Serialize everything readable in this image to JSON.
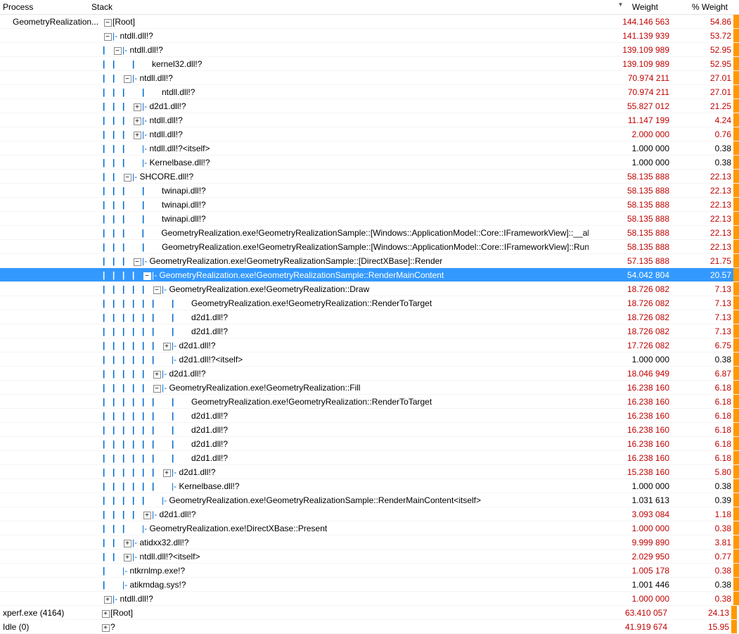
{
  "headers": {
    "process": "Process",
    "stack": "Stack",
    "weight": "Weight",
    "pct": "% Weight"
  },
  "rows": [
    {
      "proc": "GeometryRealization...",
      "exp": "-",
      "depth": 0,
      "pre": "",
      "label": "[Root]",
      "w": "144.146 563",
      "p": "54.86",
      "cls": "r",
      "bar": 1
    },
    {
      "proc": "",
      "exp": "-",
      "depth": 0,
      "pre": "|- ",
      "label": "ntdll.dll!?",
      "w": "141.139 939",
      "p": "53.72",
      "cls": "r",
      "bar": 1,
      "pad": 1
    },
    {
      "proc": "",
      "exp": "-",
      "depth": 1,
      "pre": "|- ",
      "label": "ntdll.dll!?",
      "w": "139.109 989",
      "p": "52.95",
      "cls": "r",
      "bar": 1,
      "pad": 1
    },
    {
      "proc": "",
      "exp": "",
      "depth": 2,
      "pre": "",
      "label": "kernel32.dll!?",
      "w": "139.109 989",
      "p": "52.95",
      "cls": "r",
      "bar": 1,
      "pad": 1,
      "extraPipe": 1
    },
    {
      "proc": "",
      "exp": "-",
      "depth": 2,
      "pre": "|- ",
      "label": "ntdll.dll!?",
      "w": "70.974 211",
      "p": "27.01",
      "cls": "r",
      "bar": 1,
      "pad": 1
    },
    {
      "proc": "",
      "exp": "",
      "depth": 3,
      "pre": "",
      "label": "ntdll.dll!?",
      "w": "70.974 211",
      "p": "27.01",
      "cls": "r",
      "bar": 1,
      "pad": 1,
      "extraPipe": 1
    },
    {
      "proc": "",
      "exp": "+",
      "depth": 3,
      "pre": "|- ",
      "label": "d2d1.dll!?",
      "w": "55.827 012",
      "p": "21.25",
      "cls": "r",
      "bar": 1,
      "pad": 1
    },
    {
      "proc": "",
      "exp": "+",
      "depth": 3,
      "pre": "|- ",
      "label": "ntdll.dll!?",
      "w": "11.147 199",
      "p": "4.24",
      "cls": "r",
      "bar": 1,
      "pad": 1
    },
    {
      "proc": "",
      "exp": "+",
      "depth": 3,
      "pre": "|- ",
      "label": "ntdll.dll!?",
      "w": "2.000 000",
      "p": "0.76",
      "cls": "r",
      "bar": 1,
      "pad": 1
    },
    {
      "proc": "",
      "exp": "",
      "depth": 3,
      "pre": "|- ",
      "label": "ntdll.dll!?<itself>",
      "w": "1.000 000",
      "p": "0.38",
      "cls": "b",
      "bar": 1,
      "pad": 1
    },
    {
      "proc": "",
      "exp": "",
      "depth": 3,
      "pre": "|- ",
      "label": "Kernelbase.dll!?",
      "w": "1.000 000",
      "p": "0.38",
      "cls": "b",
      "bar": 1,
      "pad": 1
    },
    {
      "proc": "",
      "exp": "-",
      "depth": 2,
      "pre": "|- ",
      "label": "SHCORE.dll!?",
      "w": "58.135 888",
      "p": "22.13",
      "cls": "r",
      "bar": 1,
      "pad": 1
    },
    {
      "proc": "",
      "exp": "",
      "depth": 3,
      "pre": "",
      "label": "twinapi.dll!?",
      "w": "58.135 888",
      "p": "22.13",
      "cls": "r",
      "bar": 1,
      "pad": 1,
      "extraPipe": 1
    },
    {
      "proc": "",
      "exp": "",
      "depth": 3,
      "pre": "",
      "label": "twinapi.dll!?",
      "w": "58.135 888",
      "p": "22.13",
      "cls": "r",
      "bar": 1,
      "pad": 1,
      "extraPipe": 1
    },
    {
      "proc": "",
      "exp": "",
      "depth": 3,
      "pre": "",
      "label": "twinapi.dll!?",
      "w": "58.135 888",
      "p": "22.13",
      "cls": "r",
      "bar": 1,
      "pad": 1,
      "extraPipe": 1
    },
    {
      "proc": "",
      "exp": "",
      "depth": 3,
      "pre": "",
      "label": "GeometryRealization.exe!GeometryRealizationSample::[Windows::ApplicationModel::Core::IFrameworkView]::__abi_",
      "w": "58.135 888",
      "p": "22.13",
      "cls": "r",
      "bar": 1,
      "pad": 1,
      "extraPipe": 1
    },
    {
      "proc": "",
      "exp": "",
      "depth": 3,
      "pre": "",
      "label": "GeometryRealization.exe!GeometryRealizationSample::[Windows::ApplicationModel::Core::IFrameworkView]::Run",
      "w": "58.135 888",
      "p": "22.13",
      "cls": "r",
      "bar": 1,
      "pad": 1,
      "extraPipe": 1
    },
    {
      "proc": "",
      "exp": "-",
      "depth": 3,
      "pre": "|- ",
      "label": "GeometryRealization.exe!GeometryRealizationSample::[DirectXBase]::Render",
      "w": "57.135 888",
      "p": "21.75",
      "cls": "r",
      "bar": 1,
      "pad": 1
    },
    {
      "proc": "",
      "exp": "-",
      "depth": 4,
      "pre": "|- ",
      "label": "GeometryRealization.exe!GeometryRealizationSample::RenderMainContent",
      "w": "54.042 804",
      "p": "20.57",
      "cls": "r",
      "bar": 1,
      "pad": 1,
      "sel": 1
    },
    {
      "proc": "",
      "exp": "-",
      "depth": 5,
      "pre": "|- ",
      "label": "GeometryRealization.exe!GeometryRealization::Draw",
      "w": "18.726 082",
      "p": "7.13",
      "cls": "r",
      "bar": 1,
      "pad": 1
    },
    {
      "proc": "",
      "exp": "",
      "depth": 6,
      "pre": "",
      "label": "GeometryRealization.exe!GeometryRealization::RenderToTarget",
      "w": "18.726 082",
      "p": "7.13",
      "cls": "r",
      "bar": 1,
      "pad": 1,
      "extraPipe": 1
    },
    {
      "proc": "",
      "exp": "",
      "depth": 6,
      "pre": "",
      "label": "d2d1.dll!?",
      "w": "18.726 082",
      "p": "7.13",
      "cls": "r",
      "bar": 1,
      "pad": 1,
      "extraPipe": 1
    },
    {
      "proc": "",
      "exp": "",
      "depth": 6,
      "pre": "",
      "label": "d2d1.dll!?",
      "w": "18.726 082",
      "p": "7.13",
      "cls": "r",
      "bar": 1,
      "pad": 1,
      "extraPipe": 1
    },
    {
      "proc": "",
      "exp": "+",
      "depth": 6,
      "pre": "|- ",
      "label": "d2d1.dll!?",
      "w": "17.726 082",
      "p": "6.75",
      "cls": "r",
      "bar": 1,
      "pad": 1
    },
    {
      "proc": "",
      "exp": "",
      "depth": 6,
      "pre": "|- ",
      "label": "d2d1.dll!?<itself>",
      "w": "1.000 000",
      "p": "0.38",
      "cls": "b",
      "bar": 1,
      "pad": 1
    },
    {
      "proc": "",
      "exp": "+",
      "depth": 5,
      "pre": "|- ",
      "label": "d2d1.dll!?",
      "w": "18.046 949",
      "p": "6.87",
      "cls": "r",
      "bar": 1,
      "pad": 1
    },
    {
      "proc": "",
      "exp": "-",
      "depth": 5,
      "pre": "|- ",
      "label": "GeometryRealization.exe!GeometryRealization::Fill",
      "w": "16.238 160",
      "p": "6.18",
      "cls": "r",
      "bar": 1,
      "pad": 1
    },
    {
      "proc": "",
      "exp": "",
      "depth": 6,
      "pre": "",
      "label": "GeometryRealization.exe!GeometryRealization::RenderToTarget",
      "w": "16.238 160",
      "p": "6.18",
      "cls": "r",
      "bar": 1,
      "pad": 1,
      "extraPipe": 1
    },
    {
      "proc": "",
      "exp": "",
      "depth": 6,
      "pre": "",
      "label": "d2d1.dll!?",
      "w": "16.238 160",
      "p": "6.18",
      "cls": "r",
      "bar": 1,
      "pad": 1,
      "extraPipe": 1
    },
    {
      "proc": "",
      "exp": "",
      "depth": 6,
      "pre": "",
      "label": "d2d1.dll!?",
      "w": "16.238 160",
      "p": "6.18",
      "cls": "r",
      "bar": 1,
      "pad": 1,
      "extraPipe": 1
    },
    {
      "proc": "",
      "exp": "",
      "depth": 6,
      "pre": "",
      "label": "d2d1.dll!?",
      "w": "16.238 160",
      "p": "6.18",
      "cls": "r",
      "bar": 1,
      "pad": 1,
      "extraPipe": 1
    },
    {
      "proc": "",
      "exp": "",
      "depth": 6,
      "pre": "",
      "label": "d2d1.dll!?",
      "w": "16.238 160",
      "p": "6.18",
      "cls": "r",
      "bar": 1,
      "pad": 1,
      "extraPipe": 1
    },
    {
      "proc": "",
      "exp": "+",
      "depth": 6,
      "pre": "|- ",
      "label": "d2d1.dll!?",
      "w": "15.238 160",
      "p": "5.80",
      "cls": "r",
      "bar": 1,
      "pad": 1
    },
    {
      "proc": "",
      "exp": "",
      "depth": 6,
      "pre": "|- ",
      "label": "Kernelbase.dll!?",
      "w": "1.000 000",
      "p": "0.38",
      "cls": "b",
      "bar": 1,
      "pad": 1
    },
    {
      "proc": "",
      "exp": "",
      "depth": 5,
      "pre": "|- ",
      "label": "GeometryRealization.exe!GeometryRealizationSample::RenderMainContent<itself>",
      "w": "1.031 613",
      "p": "0.39",
      "cls": "b",
      "bar": 1,
      "pad": 1
    },
    {
      "proc": "",
      "exp": "+",
      "depth": 4,
      "pre": "|- ",
      "label": "d2d1.dll!?",
      "w": "3.093 084",
      "p": "1.18",
      "cls": "r",
      "bar": 1,
      "pad": 1
    },
    {
      "proc": "",
      "exp": "",
      "depth": 3,
      "pre": "|- ",
      "label": "GeometryRealization.exe!DirectXBase::Present",
      "w": "1.000 000",
      "p": "0.38",
      "cls": "r",
      "bar": 1,
      "pad": 1
    },
    {
      "proc": "",
      "exp": "+",
      "depth": 2,
      "pre": "|- ",
      "label": "atidxx32.dll!?",
      "w": "9.999 890",
      "p": "3.81",
      "cls": "r",
      "bar": 1,
      "pad": 1
    },
    {
      "proc": "",
      "exp": "+",
      "depth": 2,
      "pre": "|- ",
      "label": "ntdll.dll!?<itself>",
      "w": "2.029 950",
      "p": "0.77",
      "cls": "r",
      "bar": 1,
      "pad": 1
    },
    {
      "proc": "",
      "exp": "",
      "depth": 1,
      "pre": "|- ",
      "label": "ntkrnlmp.exe!?",
      "w": "1.005 178",
      "p": "0.38",
      "cls": "r",
      "bar": 1,
      "pad": 1
    },
    {
      "proc": "",
      "exp": "",
      "depth": 1,
      "pre": "|- ",
      "label": "atikmdag.sys!?",
      "w": "1.001 446",
      "p": "0.38",
      "cls": "b",
      "bar": 1,
      "pad": 1
    },
    {
      "proc": "",
      "exp": "+",
      "depth": 0,
      "pre": "|- ",
      "label": "ntdll.dll!?",
      "w": "1.000 000",
      "p": "0.38",
      "cls": "r",
      "bar": 1,
      "pad": 1
    },
    {
      "proc": "xperf.exe (4164)",
      "exp": "+",
      "depth": 0,
      "pre": "",
      "label": "[Root]",
      "w": "63.410 057",
      "p": "24.13",
      "cls": "r",
      "bar": 1
    },
    {
      "proc": "Idle (0)",
      "exp": "+",
      "depth": 0,
      "pre": "",
      "label": "?",
      "w": "41.919 674",
      "p": "15.95",
      "cls": "r",
      "bar": 1
    }
  ]
}
